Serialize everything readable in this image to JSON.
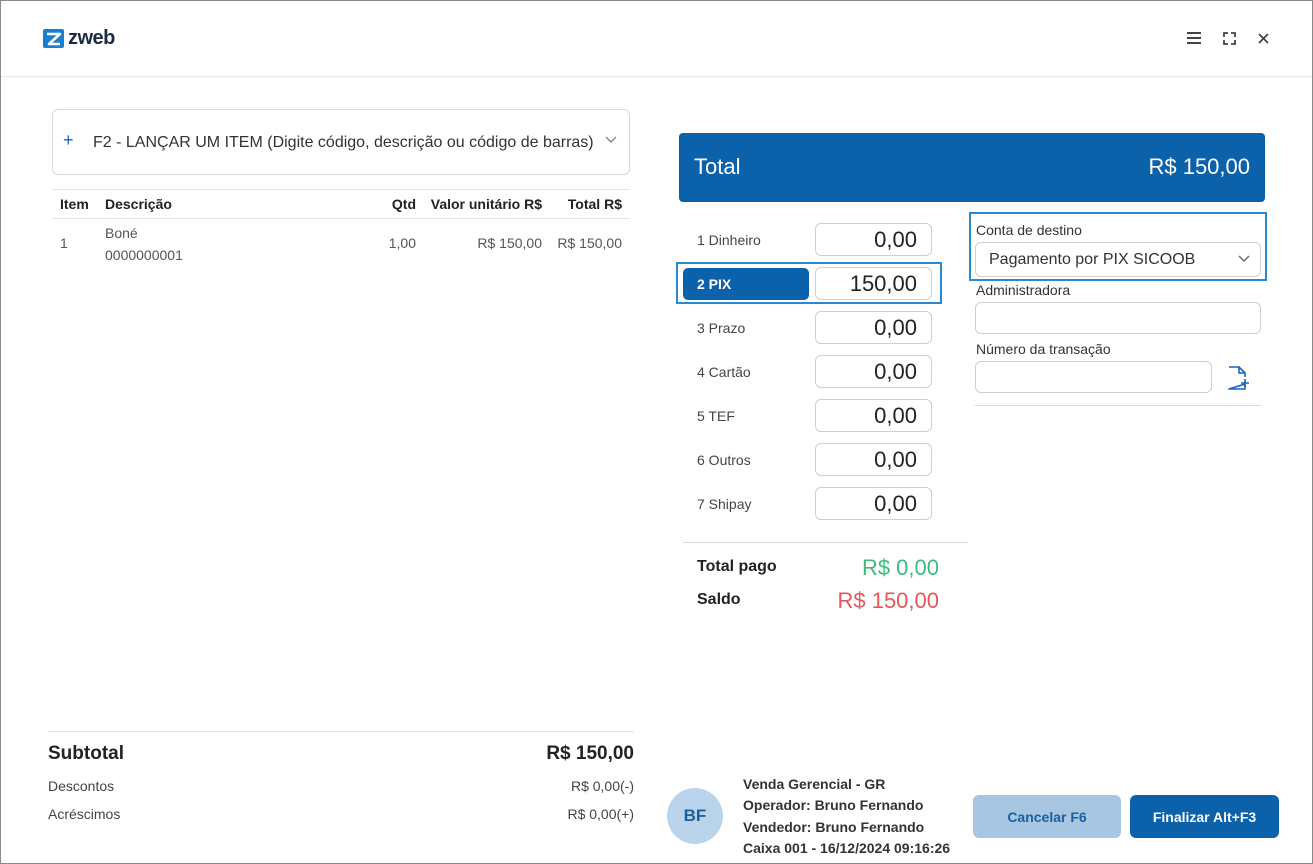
{
  "app": {
    "logo_text": "zweb",
    "brand_color": "#0c61ab"
  },
  "window_controls": [
    "menu-icon",
    "fullscreen-icon",
    "close-icon"
  ],
  "item_search": {
    "placeholder": "F2 - LANÇAR UM ITEM (Digite código, descrição ou código de barras)"
  },
  "items_table": {
    "columns": {
      "item": "Item",
      "description": "Descrição",
      "qty": "Qtd",
      "unit_price": "Valor unitário R$",
      "total": "Total R$"
    },
    "rows": [
      {
        "item": "1",
        "description": "Boné",
        "code": "0000000001",
        "qty": "1,00",
        "unit_price": "R$ 150,00",
        "total": "R$ 150,00"
      }
    ]
  },
  "summary": {
    "subtotal_label": "Subtotal",
    "subtotal_value": "R$ 150,00",
    "discounts_label": "Descontos",
    "discounts_value": "R$ 0,00(-)",
    "additions_label": "Acréscimos",
    "additions_value": "R$ 0,00(+)"
  },
  "total": {
    "label": "Total",
    "value": "R$ 150,00"
  },
  "payment_methods": [
    {
      "label": "1 Dinheiro",
      "value": "0,00",
      "active": false
    },
    {
      "label": "2 PIX",
      "value": "150,00",
      "active": true
    },
    {
      "label": "3 Prazo",
      "value": "0,00",
      "active": false
    },
    {
      "label": "4 Cartão",
      "value": "0,00",
      "active": false
    },
    {
      "label": "5 TEF",
      "value": "0,00",
      "active": false
    },
    {
      "label": "6 Outros",
      "value": "0,00",
      "active": false
    },
    {
      "label": "7 Shipay",
      "value": "0,00",
      "active": false
    }
  ],
  "payment_totals": {
    "paid_label": "Total pago",
    "paid_value": "R$ 0,00",
    "paid_color": "#3dbb7c",
    "balance_label": "Saldo",
    "balance_value": "R$ 150,00",
    "balance_color": "#e05a5a"
  },
  "pix_form": {
    "destination_label": "Conta de destino",
    "destination_value": "Pagamento por PIX SICOOB",
    "administrator_label": "Administradora",
    "administrator_value": "",
    "transaction_label": "Número da transação",
    "transaction_value": ""
  },
  "session": {
    "avatar_initials": "BF",
    "sale_type": "Venda Gerencial - GR",
    "operator": "Operador: Bruno Fernando",
    "seller": "Vendedor: Bruno Fernando",
    "register": "Caixa 001 - 16/12/2024 09:16:26"
  },
  "actions": {
    "cancel_label": "Cancelar F6",
    "finish_label": "Finalizar Alt+F3"
  }
}
